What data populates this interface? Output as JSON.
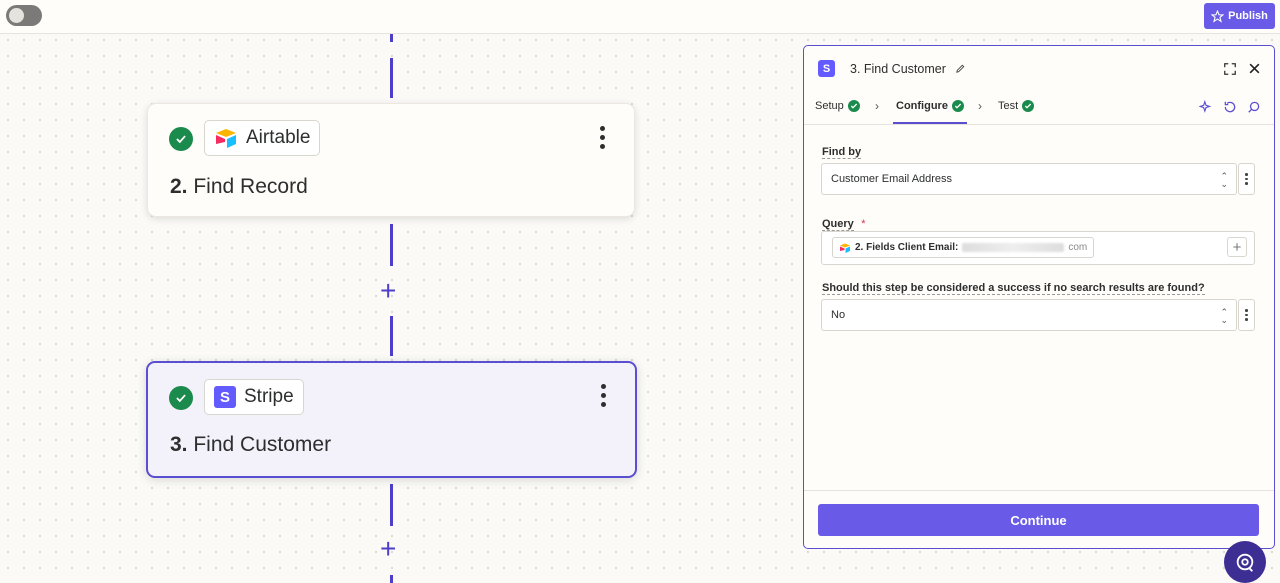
{
  "topbar": {
    "publish_label": "Publish"
  },
  "canvas": {
    "cards": [
      {
        "app": "Airtable",
        "step_number": "2.",
        "step_title": "Find Record"
      },
      {
        "app": "Stripe",
        "step_number": "3.",
        "step_title": "Find Customer"
      }
    ]
  },
  "panel": {
    "title": "3. Find Customer",
    "app_logo_letter": "S",
    "tabs": [
      {
        "label": "Setup"
      },
      {
        "label": "Configure"
      },
      {
        "label": "Test"
      }
    ],
    "fields": {
      "find_by": {
        "label": "Find by",
        "value": "Customer Email Address"
      },
      "query": {
        "label": "Query",
        "required_mark": "*",
        "pill_label": "2. Fields Client Email:",
        "pill_suffix": "com"
      },
      "success": {
        "label": "Should this step be considered a success if no search results are found?",
        "value": "No"
      }
    },
    "continue_label": "Continue"
  },
  "colors": {
    "accent": "#695be8",
    "success": "#1b8a4d",
    "flow_line": "#4d3fc9"
  }
}
